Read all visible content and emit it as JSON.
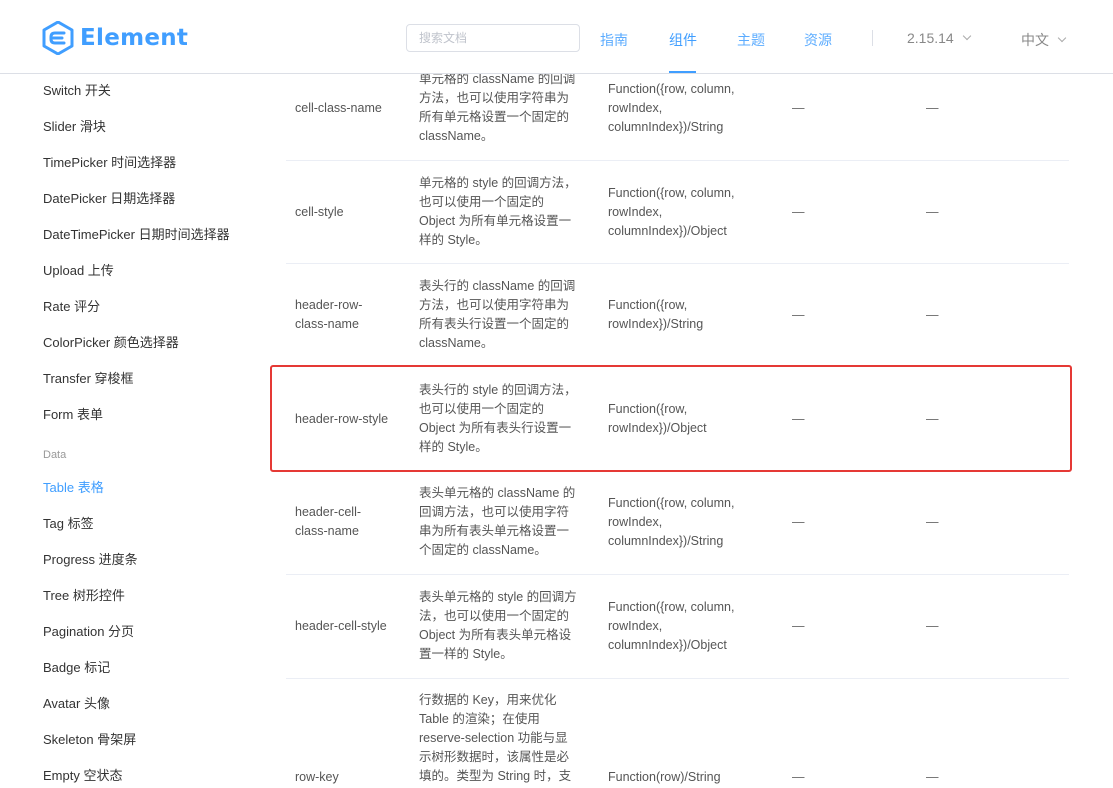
{
  "header": {
    "logo_text": "Element",
    "search_placeholder": "搜索文档",
    "nav": {
      "guide": "指南",
      "component": "组件",
      "theme": "主题",
      "resource": "资源"
    },
    "version": "2.15.14",
    "language": "中文"
  },
  "sidebar": {
    "items": [
      "Switch 开关",
      "Slider 滑块",
      "TimePicker 时间选择器",
      "DatePicker 日期选择器",
      "DateTimePicker 日期时间选择器",
      "Upload 上传",
      "Rate 评分",
      "ColorPicker 颜色选择器",
      "Transfer 穿梭框",
      "Form 表单"
    ],
    "group_data": "Data",
    "data_items": [
      "Table 表格",
      "Tag 标签",
      "Progress 进度条",
      "Tree 树形控件",
      "Pagination 分页",
      "Badge 标记",
      "Avatar 头像",
      "Skeleton 骨架屏",
      "Empty 空状态"
    ]
  },
  "table": {
    "rows": [
      {
        "name": [
          "cell-class-name"
        ],
        "desc": [
          "单元格的 className 的回调",
          "方法，也可以使用字符串为",
          "所有单元格设置一个固定的",
          "className。"
        ],
        "type": [
          "Function({row, column,",
          "rowIndex,",
          "columnIndex})/String"
        ],
        "options": "—",
        "default": "—"
      },
      {
        "name": [
          "cell-style"
        ],
        "desc": [
          "单元格的 style 的回调方法，",
          "也可以使用一个固定的",
          "Object 为所有单元格设置一",
          "样的 Style。"
        ],
        "type": [
          "Function({row, column,",
          "rowIndex,",
          "columnIndex})/Object"
        ],
        "options": "—",
        "default": "—"
      },
      {
        "name": [
          "header-row-",
          "class-name"
        ],
        "desc": [
          "表头行的 className 的回调",
          "方法，也可以使用字符串为",
          "所有表头行设置一个固定的",
          "className。"
        ],
        "type": [
          "Function({row,",
          "rowIndex})/String"
        ],
        "options": "—",
        "default": "—"
      },
      {
        "name": [
          "header-row-style"
        ],
        "desc": [
          "表头行的 style 的回调方法，",
          "也可以使用一个固定的",
          "Object 为所有表头行设置一",
          "样的 Style。"
        ],
        "type": [
          "Function({row,",
          "rowIndex})/Object"
        ],
        "options": "—",
        "default": "—"
      },
      {
        "name": [
          "header-cell-",
          "class-name"
        ],
        "desc": [
          "表头单元格的 className 的",
          "回调方法，也可以使用字符",
          "串为所有表头单元格设置一",
          "个固定的 className。"
        ],
        "type": [
          "Function({row, column,",
          "rowIndex,",
          "columnIndex})/String"
        ],
        "options": "—",
        "default": "—"
      },
      {
        "name": [
          "header-cell-style"
        ],
        "desc": [
          "表头单元格的 style 的回调方",
          "法，也可以使用一个固定的",
          "Object 为所有表头单元格设",
          "置一样的 Style。"
        ],
        "type": [
          "Function({row, column,",
          "rowIndex,",
          "columnIndex})/Object"
        ],
        "options": "—",
        "default": "—"
      },
      {
        "name": [
          "row-key"
        ],
        "desc": [
          "行数据的 Key，用来优化",
          "Table 的渲染；在使用",
          "reserve-selection 功能与显",
          "示树形数据时，该属性是必",
          "填的。类型为 String 时，支"
        ],
        "type": [
          "Function(row)/String"
        ],
        "options": "—",
        "default": "—"
      }
    ]
  }
}
